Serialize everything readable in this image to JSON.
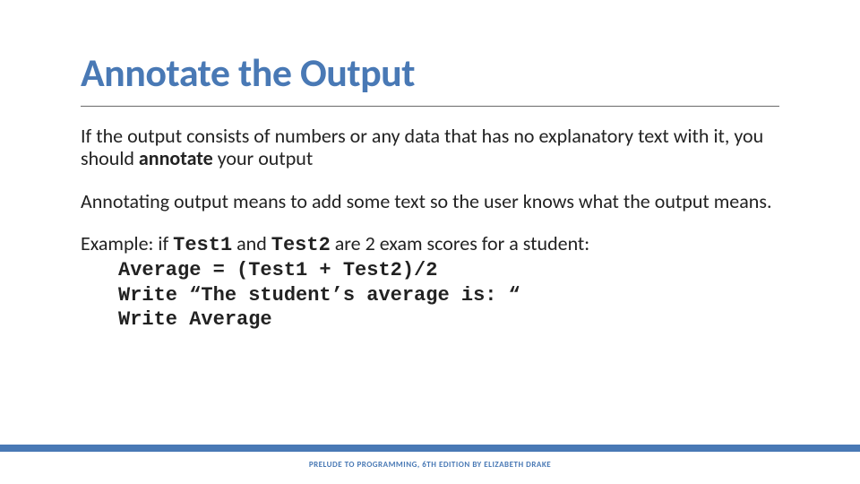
{
  "title": "Annotate the Output",
  "para1_a": "If the output consists of numbers or any data that has no explanatory text with it, you should ",
  "para1_bold": "annotate ",
  "para1_b": "your output",
  "para2": "Annotating output means to add some text so the user knows what the output means.",
  "ex_intro1": "Example: if ",
  "ex_var1": "Test1",
  "ex_intro2": " and ",
  "ex_var2": "Test2",
  "ex_intro3": " are 2 exam scores for a student:",
  "code1": "Average = (Test1 + Test2)/2",
  "code2": "Write “The student’s average is: “",
  "code3": "Write Average",
  "footer": "PRELUDE TO PROGRAMMING, 6TH EDITION BY ELIZABETH DRAKE"
}
